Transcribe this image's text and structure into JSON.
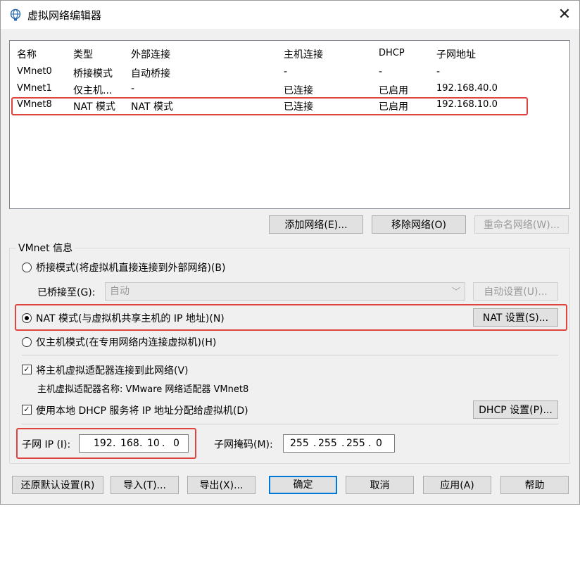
{
  "window": {
    "title": "虚拟网络编辑器",
    "close_symbol": "✕"
  },
  "network_table": {
    "columns": [
      "名称",
      "类型",
      "外部连接",
      "主机连接",
      "DHCP",
      "子网地址"
    ],
    "rows": [
      [
        "VMnet0",
        "桥接模式",
        "自动桥接",
        "-",
        "-",
        "-"
      ],
      [
        "VMnet1",
        "仅主机...",
        "-",
        "已连接",
        "已启用",
        "192.168.40.0"
      ],
      [
        "VMnet8",
        "NAT 模式",
        "NAT 模式",
        "已连接",
        "已启用",
        "192.168.10.0"
      ]
    ]
  },
  "table_buttons": {
    "add": "添加网络(E)...",
    "remove": "移除网络(O)",
    "rename": "重命名网络(W)..."
  },
  "vmnet_info": {
    "legend": "VMnet 信息",
    "bridged_label": "桥接模式(将虚拟机直接连接到外部网络)(B)",
    "bridged_to_label": "已桥接至(G):",
    "bridged_to_value": "自动",
    "auto_settings": "自动设置(U)...",
    "nat_label": "NAT 模式(与虚拟机共享主机的 IP 地址)(N)",
    "nat_settings": "NAT 设置(S)...",
    "hostonly_label": "仅主机模式(在专用网络内连接虚拟机)(H)",
    "connect_adapter_label": "将主机虚拟适配器连接到此网络(V)",
    "adapter_name_label": "主机虚拟适配器名称: VMware 网络适配器 VMnet8",
    "dhcp_label": "使用本地 DHCP 服务将 IP 地址分配给虚拟机(D)",
    "dhcp_settings": "DHCP 设置(P)...",
    "check_mark": "✓",
    "subnet_ip_label": "子网 IP (I):",
    "subnet_ip": [
      "192",
      "168",
      "10",
      "0"
    ],
    "subnet_mask_label": "子网掩码(M):",
    "subnet_mask": [
      "255",
      "255",
      "255",
      "0"
    ],
    "ip_dot": "."
  },
  "footer_buttons": {
    "restore": "还原默认设置(R)",
    "import": "导入(T)...",
    "export": "导出(X)...",
    "ok": "确定",
    "cancel": "取消",
    "apply": "应用(A)",
    "help": "帮助"
  },
  "colors": {
    "highlight_box": "#e0443e",
    "default_button_border": "#0078d7"
  }
}
